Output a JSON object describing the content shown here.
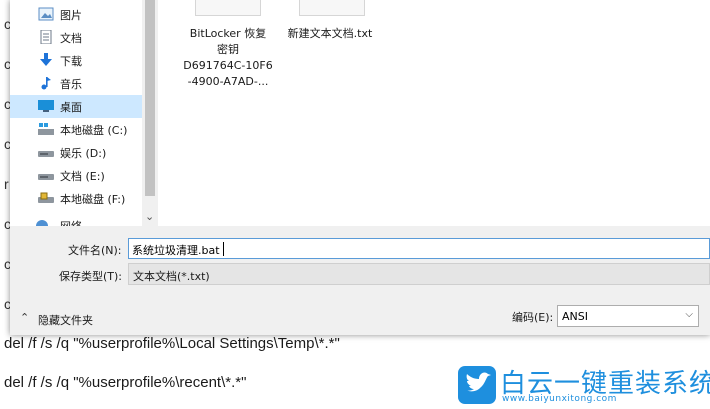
{
  "nav": {
    "items": [
      {
        "label": "图片",
        "icon": "pictures-icon"
      },
      {
        "label": "文档",
        "icon": "documents-icon"
      },
      {
        "label": "下载",
        "icon": "download-icon"
      },
      {
        "label": "音乐",
        "icon": "music-icon"
      },
      {
        "label": "桌面",
        "icon": "desktop-icon",
        "selected": true
      },
      {
        "label": "本地磁盘 (C:)",
        "icon": "windows-drive-icon"
      },
      {
        "label": "娱乐 (D:)",
        "icon": "drive-icon"
      },
      {
        "label": "文档 (E:)",
        "icon": "drive-icon"
      },
      {
        "label": "本地磁盘 (F:)",
        "icon": "locked-drive-icon"
      },
      {
        "label": "网络",
        "icon": "network-icon"
      }
    ]
  },
  "files": [
    {
      "name_lines": [
        "BitLocker 恢复",
        "密钥",
        "D691764C-10F6",
        "-4900-A7AD-..."
      ],
      "icon": "text-file-icon"
    },
    {
      "name_lines": [
        "新建文本文档.txt"
      ],
      "icon": "text-file-icon"
    }
  ],
  "form": {
    "filename_label": "文件名(N):",
    "filename_value": "系统垃圾清理.bat",
    "filetype_label": "保存类型(T):",
    "filetype_value": "文本文档(*.txt)",
    "hide_folders_label": "隐藏文件夹",
    "encoding_label": "编码(E):",
    "encoding_value": "ANSI"
  },
  "background_lines": [
    "del /f /s /q \"%userprofile%\\Local Settings\\Temp\\*.*\"",
    "del /f /s /q \"%userprofile%\\recent\\*.*\""
  ],
  "watermark": {
    "title": "白云一键重装系统",
    "url": "www.baiyunxitong.com"
  },
  "colors": {
    "accent": "#1e8fde",
    "selection": "#cde8ff"
  }
}
